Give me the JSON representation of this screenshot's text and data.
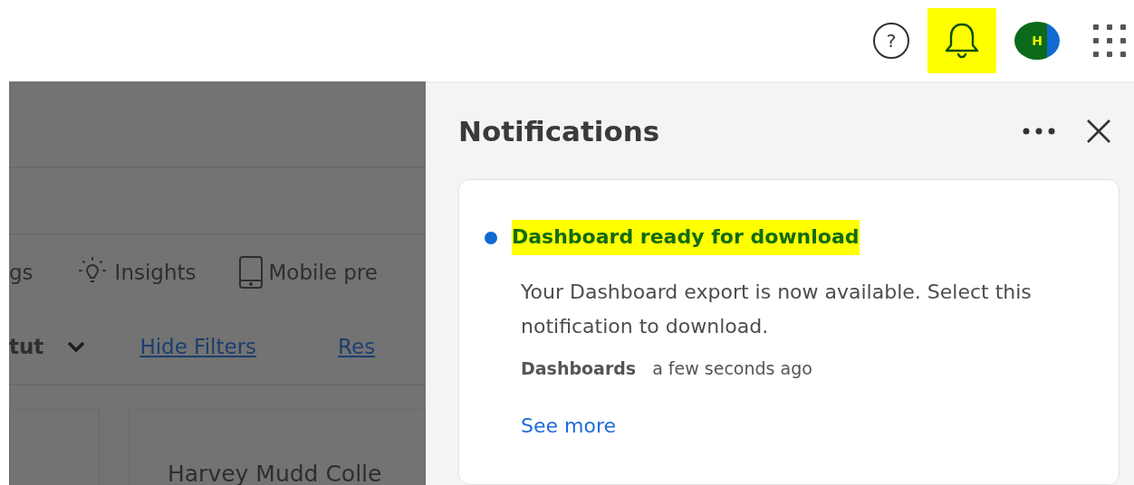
{
  "header": {
    "help_glyph": "?",
    "avatar_initial": "H",
    "bell_highlighted": true
  },
  "background_page": {
    "toolbar": [
      {
        "kind": "text",
        "label": "gs"
      },
      {
        "kind": "bulb",
        "label": "Insights"
      },
      {
        "kind": "phone",
        "label": "Mobile pre"
      }
    ],
    "filter_bar": {
      "dropdown": "tut",
      "links": [
        "Hide Filters",
        "Res"
      ]
    },
    "cards": [
      {
        "title": "Harvey Mudd Colle"
      }
    ]
  },
  "notifications": {
    "title": "Notifications",
    "items": [
      {
        "title": "Dashboard ready for download",
        "unread": true,
        "highlighted": true,
        "body": "Your Dashboard export is now available. Select this notification to download.",
        "source": "Dashboards",
        "time": "a few seconds ago",
        "link": "See more"
      }
    ]
  }
}
